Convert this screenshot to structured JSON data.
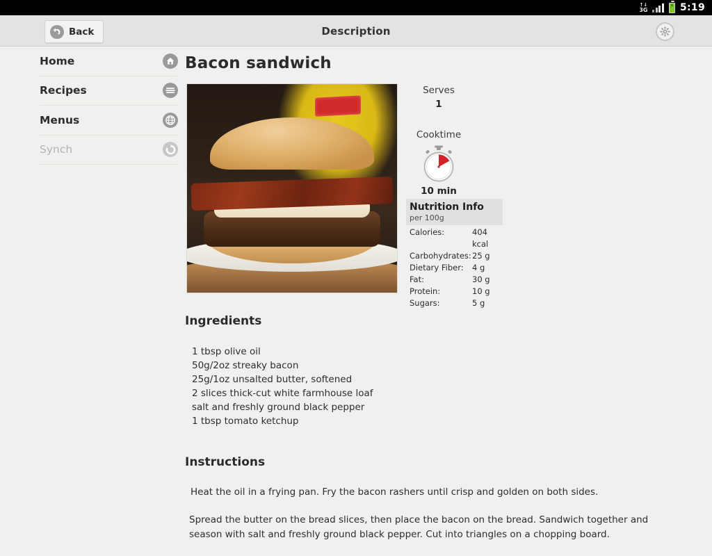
{
  "status_bar": {
    "network_type": "3G",
    "network_arrows": "↑↓",
    "time": "5:19"
  },
  "title_bar": {
    "back_label": "Back",
    "title": "Description",
    "back_icon": "back-arrow-circle-icon",
    "settings_icon": "gear-icon"
  },
  "sidebar": {
    "items": [
      {
        "label": "Home",
        "icon": "home-icon",
        "disabled": false
      },
      {
        "label": "Recipes",
        "icon": "list-icon",
        "disabled": false
      },
      {
        "label": "Menus",
        "icon": "globe-icon",
        "disabled": false
      },
      {
        "label": "Synch",
        "icon": "refresh-icon",
        "disabled": true
      }
    ]
  },
  "recipe": {
    "title": "Bacon sandwich",
    "photo_alt": "bacon-burger-photo",
    "serves_label": "Serves",
    "serves_value": "1",
    "cooktime_label": "Cooktime",
    "cooktime_value": "10 min",
    "cooktime_icon": "stopwatch-icon",
    "nutrition": {
      "title": "Nutrition Info",
      "subtitle": "per 100g",
      "rows": [
        {
          "label": "Calories:",
          "value": "404 kcal"
        },
        {
          "label": "Carbohydrates:",
          "value": "25 g"
        },
        {
          "label": "Dietary Fiber:",
          "value": "4 g"
        },
        {
          "label": "Fat:",
          "value": "30 g"
        },
        {
          "label": "Protein:",
          "value": "10 g"
        },
        {
          "label": "Sugars:",
          "value": "5 g"
        }
      ]
    },
    "ingredients_heading": "Ingredients",
    "ingredients": [
      "1 tbsp olive oil",
      "50g/2oz streaky bacon",
      "25g/1oz unsalted butter, softened",
      "2 slices thick-cut white farmhouse loaf",
      "salt and freshly ground black pepper",
      "1 tbsp tomato ketchup"
    ],
    "instructions_heading": "Instructions",
    "instructions": [
      "Heat the oil in a frying pan. Fry the bacon rashers until crisp and golden on both sides.",
      "Spread the butter on the bread slices, then place the bacon on the bread. Sandwich together and season with salt and freshly ground black pepper. Cut into triangles on a chopping board."
    ]
  },
  "colors": {
    "status_bar_bg": "#000000",
    "title_bar_bg": "#e3e3e1",
    "content_bg": "#f0f0ee",
    "nutrition_header_bg": "#e0e0de",
    "battery_green": "#7ec820",
    "stopwatch_red": "#d2232a"
  }
}
